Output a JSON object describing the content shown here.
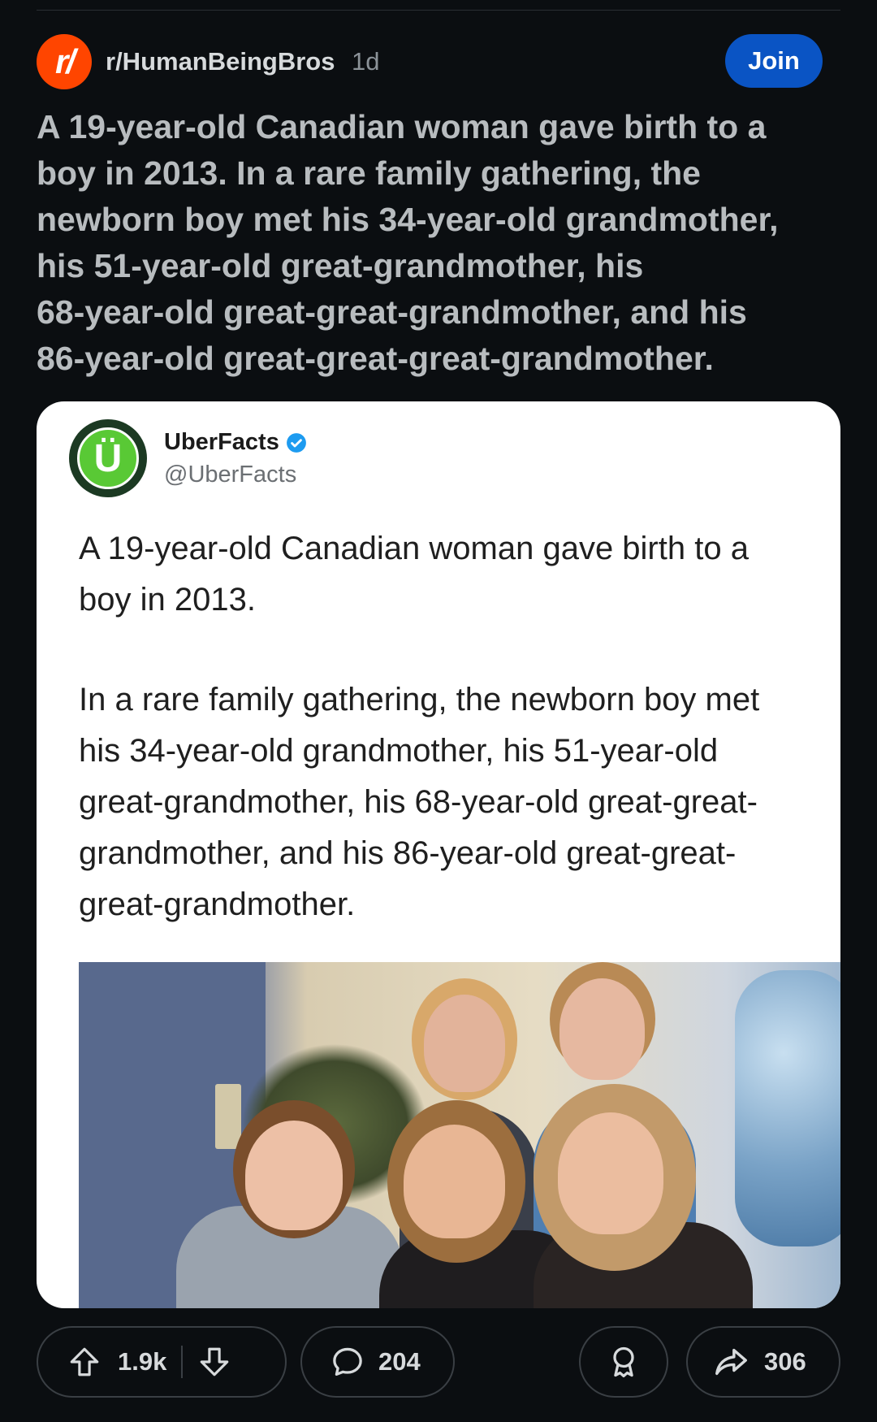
{
  "post": {
    "subreddit": "r/HumanBeingBros",
    "age": "1d",
    "join_label": "Join",
    "title_lines": [
      "A 19-year-old Canadian woman gave birth to a",
      "boy in 2013. In a rare family gathering, the",
      "newborn boy met his 34-year-old grandmother,",
      "his 51-year-old great-grandmother, his",
      "68-year-old great-great-grandmother, and his",
      "86-year-old great-great-great-grandmother."
    ]
  },
  "tweet": {
    "avatar_letter": "Ü",
    "name": "UberFacts",
    "handle": "@UberFacts",
    "paragraph1_lines": [
      "A 19-year-old Canadian woman gave birth to a",
      "boy in 2013."
    ],
    "paragraph2_lines": [
      "In a rare family gathering, the newborn boy met",
      "his 34-year-old grandmother, his 51-year-old",
      "great-grandmother, his 68-year-old great-great-",
      "grandmother, and his 86-year-old great-great-",
      "great-grandmother."
    ]
  },
  "actions": {
    "upvotes": "1.9k",
    "comments": "204",
    "shares": "306"
  },
  "colors": {
    "background": "#0b0e11",
    "subreddit_icon": "#ff4500",
    "join_button": "#0a54c4",
    "uberfacts_green": "#59c935",
    "verified_blue": "#1d9bf0"
  },
  "icons": {
    "subreddit": "reddit-r-icon",
    "verified": "verified-badge-icon",
    "upvote": "upvote-arrow-icon",
    "downvote": "downvote-arrow-icon",
    "comment": "speech-bubble-icon",
    "award": "award-ribbon-icon",
    "share": "share-arrow-icon"
  }
}
